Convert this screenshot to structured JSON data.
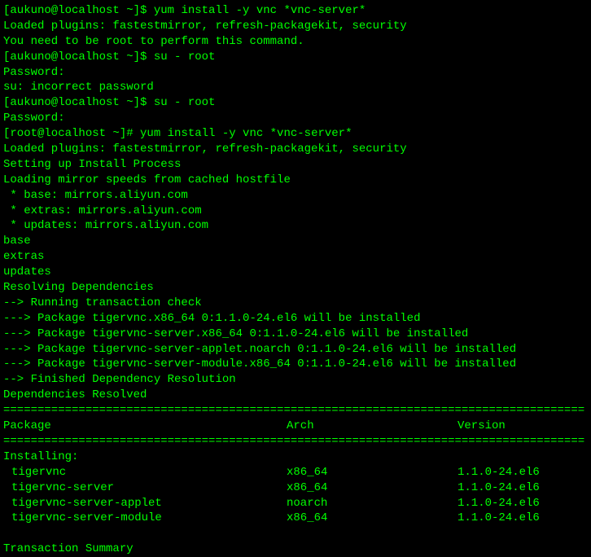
{
  "lines": {
    "l1_prompt": "[aukuno@localhost ~]$ ",
    "l1_cmd": "yum install -y vnc *vnc-server*",
    "l2": "Loaded plugins: fastestmirror, refresh-packagekit, security",
    "l3": "You need to be root to perform this command.",
    "l4_prompt": "[aukuno@localhost ~]$ ",
    "l4_cmd": "su - root",
    "l5": "Password:",
    "l6": "su: incorrect password",
    "l7_prompt": "[aukuno@localhost ~]$ ",
    "l7_cmd": "su - root",
    "l8": "Password:",
    "l9_prompt": "[root@localhost ~]# ",
    "l9_cmd": "yum install -y vnc *vnc-server*",
    "l10": "Loaded plugins: fastestmirror, refresh-packagekit, security",
    "l11": "Setting up Install Process",
    "l12": "Loading mirror speeds from cached hostfile",
    "l13": " * base: mirrors.aliyun.com",
    "l14": " * extras: mirrors.aliyun.com",
    "l15": " * updates: mirrors.aliyun.com",
    "l16": "base",
    "l17": "extras",
    "l18": "updates",
    "l19": "Resolving Dependencies",
    "l20": "--> Running transaction check",
    "l21": "---> Package tigervnc.x86_64 0:1.1.0-24.el6 will be installed",
    "l22": "---> Package tigervnc-server.x86_64 0:1.1.0-24.el6 will be installed",
    "l23": "---> Package tigervnc-server-applet.noarch 0:1.1.0-24.el6 will be installed",
    "l24": "---> Package tigervnc-server-module.x86_64 0:1.1.0-24.el6 will be installed",
    "l25": "--> Finished Dependency Resolution",
    "l26": "",
    "l27": "Dependencies Resolved",
    "l28": ""
  },
  "divider": "=====================================================================================",
  "table": {
    "header": {
      "package": " Package",
      "arch": "Arch",
      "version": "Version"
    },
    "installing_label": "Installing:",
    "rows": [
      {
        "package": "tigervnc",
        "arch": "x86_64",
        "version": "1.1.0-24.el6"
      },
      {
        "package": "tigervnc-server",
        "arch": "x86_64",
        "version": "1.1.0-24.el6"
      },
      {
        "package": "tigervnc-server-applet",
        "arch": "noarch",
        "version": "1.1.0-24.el6"
      },
      {
        "package": "tigervnc-server-module",
        "arch": "x86_64",
        "version": "1.1.0-24.el6"
      }
    ]
  },
  "footer": {
    "summary": "Transaction Summary"
  }
}
